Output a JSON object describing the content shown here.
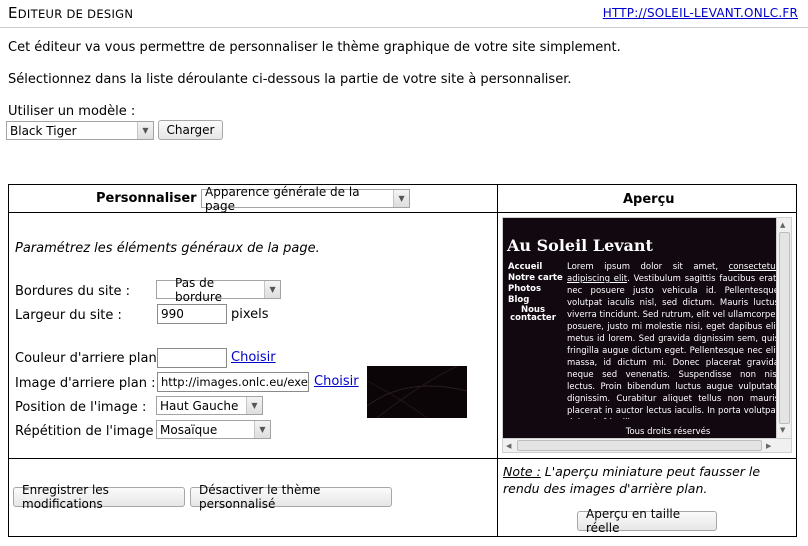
{
  "header": {
    "title_first": "E",
    "title_rest": "DITEUR DE DESIGN",
    "link": "HTTP://SOLEIL-LEVANT.ONLC.FR"
  },
  "intro": {
    "line1": "Cet éditeur va vous permettre de personnaliser le thème graphique de votre site simplement.",
    "line2": "Sélectionnez dans la liste déroulante ci-dessous la partie de votre site à personnaliser."
  },
  "model": {
    "label": "Utiliser un modèle :",
    "selected": "Black Tiger",
    "load_button": "Charger"
  },
  "customize": {
    "label": "Personnaliser :",
    "selected": "Apparence générale de la page",
    "preview_header": "Aperçu",
    "description": "Paramétrez les éléments généraux de la page.",
    "fields": {
      "borders_label": "Bordures du site :",
      "borders_value": "Pas de bordure",
      "width_label": "Largeur du site :",
      "width_value": "990",
      "width_unit": "pixels",
      "bgcolor_label": "Couleur d'arriere plan :",
      "bgcolor_value": "",
      "bgcolor_choose": "Choisir",
      "bgimage_label": "Image d'arriere plan :",
      "bgimage_value": "http://images.onlc.eu/exemp",
      "bgimage_choose": "Choisir",
      "position_label": "Position de l'image :",
      "position_value": "Haut Gauche",
      "repeat_label": "Répétition de l'image :",
      "repeat_value": "Mosaïque"
    },
    "save_button": "Enregistrer les modifications",
    "disable_button": "Désactiver le thème personnalisé",
    "note_label": "Note :",
    "note_text": " L'aperçu miniature peut fausser le rendu des images d'arrière plan.",
    "full_preview_button": "Aperçu en taille réelle"
  },
  "preview": {
    "site_title": "Au Soleil Levant",
    "nav": [
      "Accueil",
      "Notre carte",
      "Photos",
      "Blog",
      "Nous contacter"
    ],
    "content_pre": "Lorem ipsum dolor sit amet, ",
    "content_link": "consectetur adipiscing elit",
    "content_post": ". Vestibulum sagittis faucibus erat, nec posuere justo vehicula id. Pellentesque volutpat iaculis nisl, sed dictum. Mauris luctus viverra tincidunt. Sed rutrum, elit vel ullamcorper posuere, justo mi molestie nisi, eget dapibus elit metus id lorem. Sed gravida dignissim sem, quis fringilla augue dictum eget. Pellentesque nec elit massa, id dictum mi. Donec placerat gravida neque sed venenatis. Suspendisse non nisl lectus. Proin bibendum luctus augue vulputate dignissim. Curabitur aliquet tellus non mauris placerat in auctor lectus iaculis. In porta volutpat dui quis fringilla.",
    "footer": "Tous droits réservés"
  },
  "colors": {
    "link": "#0000cc",
    "preview_bg": "#120810"
  }
}
